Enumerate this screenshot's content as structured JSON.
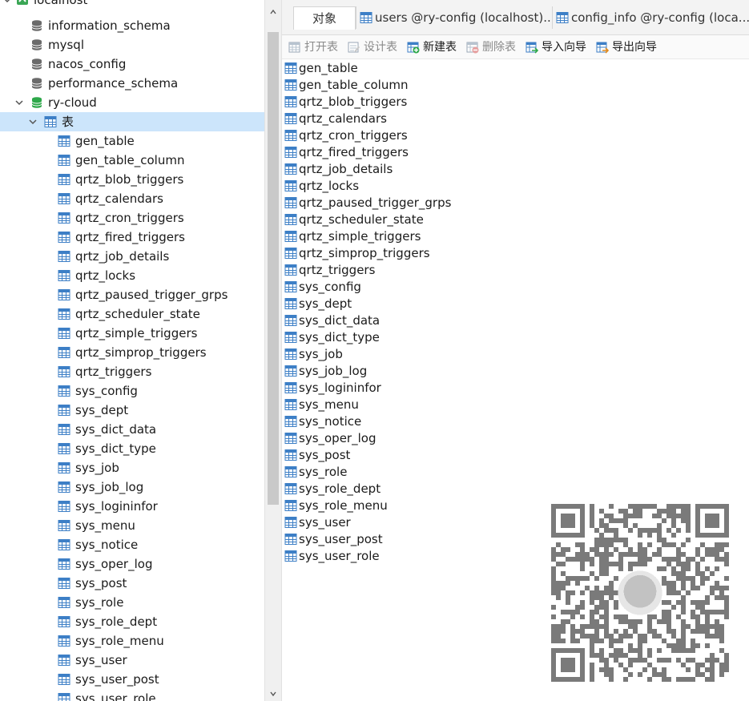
{
  "navigator": {
    "connection": "localhost",
    "databases": [
      "information_schema",
      "mysql",
      "nacos_config",
      "performance_schema"
    ],
    "open_database": "ry-cloud",
    "tables_node": "表",
    "tables": [
      "gen_table",
      "gen_table_column",
      "qrtz_blob_triggers",
      "qrtz_calendars",
      "qrtz_cron_triggers",
      "qrtz_fired_triggers",
      "qrtz_job_details",
      "qrtz_locks",
      "qrtz_paused_trigger_grps",
      "qrtz_scheduler_state",
      "qrtz_simple_triggers",
      "qrtz_simprop_triggers",
      "qrtz_triggers",
      "sys_config",
      "sys_dept",
      "sys_dict_data",
      "sys_dict_type",
      "sys_job",
      "sys_job_log",
      "sys_logininfor",
      "sys_menu",
      "sys_notice",
      "sys_oper_log",
      "sys_post",
      "sys_role",
      "sys_role_dept",
      "sys_role_menu",
      "sys_user",
      "sys_user_post",
      "sys_user_role"
    ]
  },
  "tabs": [
    {
      "label": "对象",
      "active": true
    },
    {
      "label": "users @ry-config (localhost)...",
      "active": false
    },
    {
      "label": "config_info @ry-config (loca...",
      "active": false
    }
  ],
  "toolbar": {
    "open_table": "打开表",
    "design_table": "设计表",
    "new_table": "新建表",
    "delete_table": "删除表",
    "import_wizard": "导入向导",
    "export_wizard": "导出向导"
  },
  "objects": [
    "gen_table",
    "gen_table_column",
    "qrtz_blob_triggers",
    "qrtz_calendars",
    "qrtz_cron_triggers",
    "qrtz_fired_triggers",
    "qrtz_job_details",
    "qrtz_locks",
    "qrtz_paused_trigger_grps",
    "qrtz_scheduler_state",
    "qrtz_simple_triggers",
    "qrtz_simprop_triggers",
    "qrtz_triggers",
    "sys_config",
    "sys_dept",
    "sys_dict_data",
    "sys_dict_type",
    "sys_job",
    "sys_job_log",
    "sys_logininfor",
    "sys_menu",
    "sys_notice",
    "sys_oper_log",
    "sys_post",
    "sys_role",
    "sys_role_dept",
    "sys_role_menu",
    "sys_user",
    "sys_user_post",
    "sys_user_role"
  ],
  "colors": {
    "selection": "#cce5fb",
    "db_green": "#2ea84a",
    "table_icon": "#3d7fc6",
    "accent_tab": "#5ba0e0"
  },
  "icons": {
    "connection": "connection-icon",
    "database": "database-icon",
    "open_database": "database-open-icon",
    "table": "table-icon",
    "expand": "chevron-down-icon",
    "qr": "qr-code-icon"
  }
}
